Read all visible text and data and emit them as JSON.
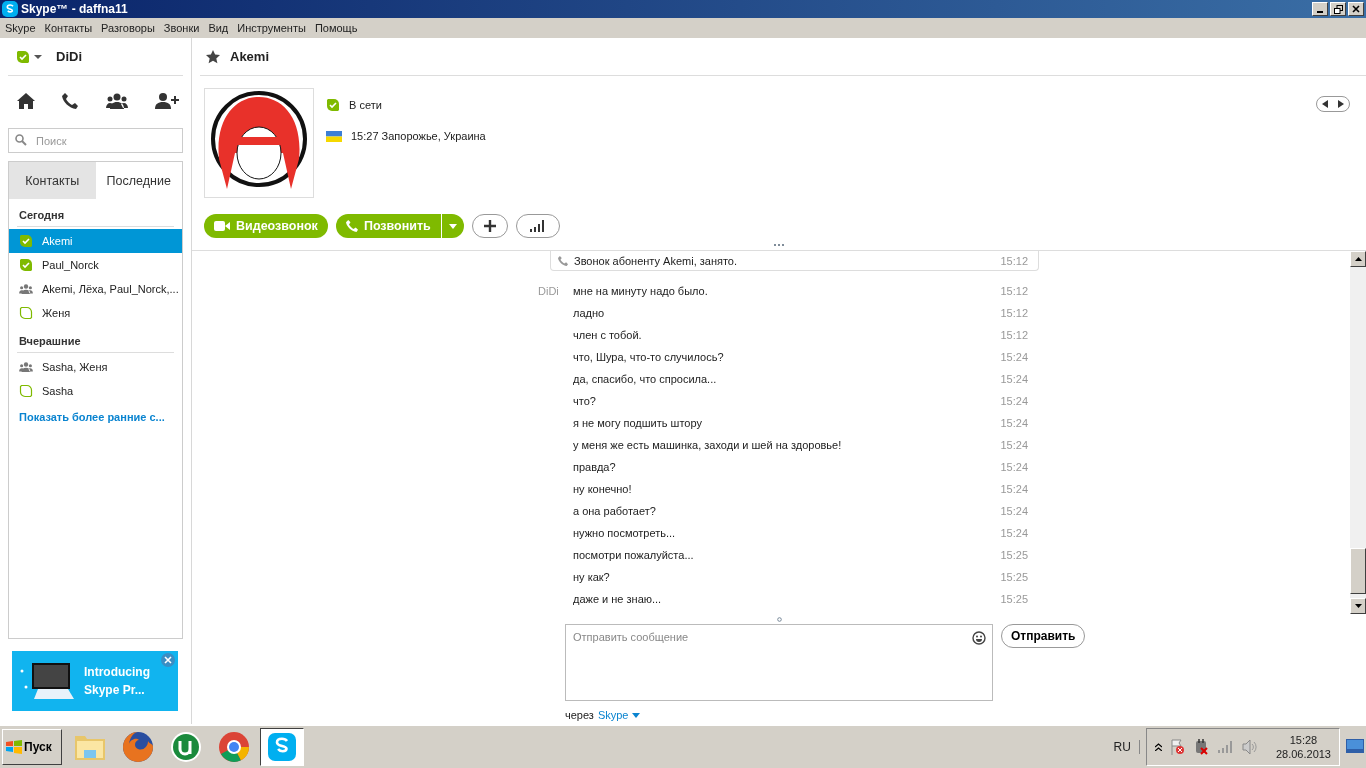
{
  "window": {
    "title": "Skype™ - daffna11"
  },
  "menu": [
    "Skype",
    "Контакты",
    "Разговоры",
    "Звонки",
    "Вид",
    "Инструменты",
    "Помощь"
  ],
  "account": {
    "name": "DiDi"
  },
  "search": {
    "placeholder": "Поиск"
  },
  "tabs": [
    {
      "label": "Контакты",
      "selected": false
    },
    {
      "label": "Последние",
      "selected": true
    }
  ],
  "recent_groups": [
    {
      "heading": "Сегодня",
      "items": [
        {
          "name": "Akemi",
          "kind": "online",
          "selected": true
        },
        {
          "name": "Paul_Norck",
          "kind": "online",
          "selected": false
        },
        {
          "name": "Akemi, Лёха, Paul_Norck,...",
          "kind": "group",
          "selected": false
        },
        {
          "name": "Женя",
          "kind": "offline",
          "selected": false
        }
      ]
    },
    {
      "heading": "Вчерашние",
      "items": [
        {
          "name": "Sasha, Женя",
          "kind": "group",
          "selected": false
        },
        {
          "name": "Sasha",
          "kind": "offline",
          "selected": false
        }
      ]
    }
  ],
  "show_more": "Показать более ранние с...",
  "promo": {
    "lines": [
      "Introducing",
      "Skype Pr..."
    ]
  },
  "contact": {
    "name": "Akemi",
    "status": "В сети",
    "local_info": "15:27 Запорожье, Украина"
  },
  "actions": {
    "video": "Видеозвонок",
    "call": "Позвонить"
  },
  "messages": [
    {
      "kind": "call",
      "text": "Звонок абоненту Akemi, занято.",
      "time": "15:12"
    },
    {
      "kind": "message",
      "sender": "DiDi",
      "text": "мне на минуту надо было.",
      "time": "15:12"
    },
    {
      "kind": "message",
      "text": "ладно",
      "time": "15:12"
    },
    {
      "kind": "message",
      "text": "член с тобой.",
      "time": "15:12"
    },
    {
      "kind": "message",
      "text": "что, Шура, что-то случилось?",
      "time": "15:24"
    },
    {
      "kind": "message",
      "text": "да, спасибо, что спросила...",
      "time": "15:24"
    },
    {
      "kind": "message",
      "text": "что?",
      "time": "15:24"
    },
    {
      "kind": "message",
      "text": "я не могу подшить штору",
      "time": "15:24"
    },
    {
      "kind": "message",
      "text": "у меня же есть машинка, заходи и шей на здоровье!",
      "time": "15:24"
    },
    {
      "kind": "message",
      "text": "правда?",
      "time": "15:24"
    },
    {
      "kind": "message",
      "text": "ну конечно!",
      "time": "15:24"
    },
    {
      "kind": "message",
      "text": "а она работает?",
      "time": "15:24"
    },
    {
      "kind": "message",
      "text": "нужно посмотреть...",
      "time": "15:24"
    },
    {
      "kind": "message",
      "text": "посмотри пожалуйста...",
      "time": "15:25"
    },
    {
      "kind": "message",
      "text": "ну как?",
      "time": "15:25"
    },
    {
      "kind": "message",
      "text": "даже и не знаю...",
      "time": "15:25"
    }
  ],
  "compose": {
    "placeholder": "Отправить сообщение",
    "send": "Отправить",
    "via_label": "через",
    "via": "Skype"
  },
  "taskbar": {
    "start": "Пуск",
    "apps": [
      {
        "kind": "explorer",
        "selected": false
      },
      {
        "kind": "firefox",
        "selected": false
      },
      {
        "kind": "utorrent",
        "selected": false
      },
      {
        "kind": "chrome",
        "selected": false
      },
      {
        "kind": "skype",
        "selected": true
      }
    ],
    "language": "RU",
    "time": "15:28",
    "date": "28.06.2013"
  }
}
